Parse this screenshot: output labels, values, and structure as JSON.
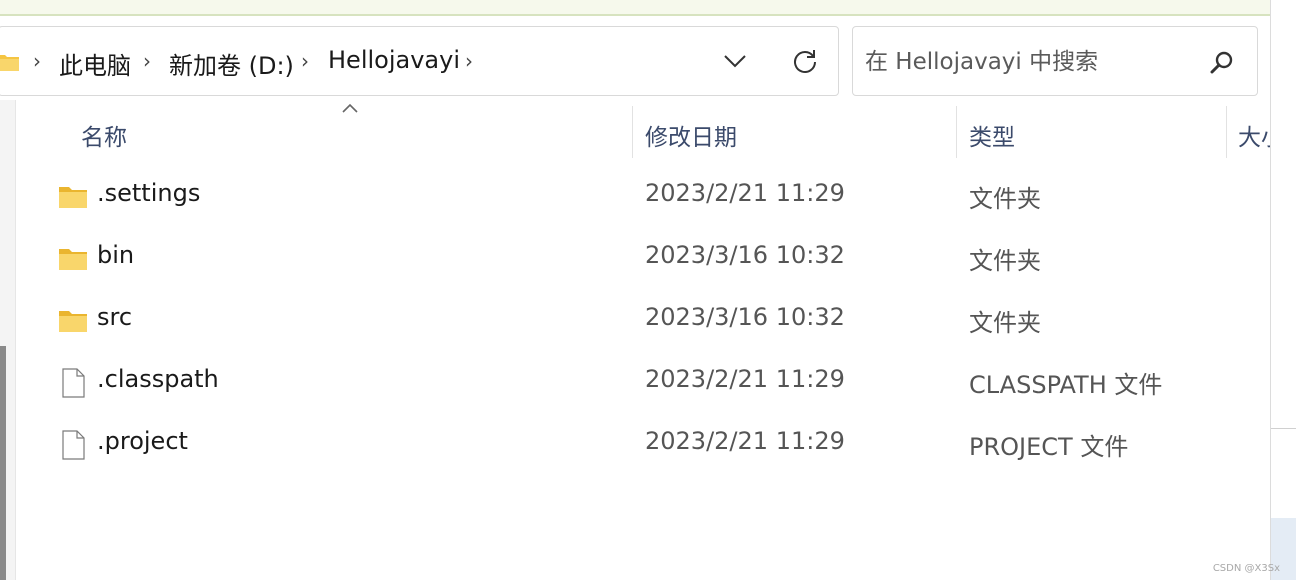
{
  "breadcrumb": {
    "items": [
      {
        "label": "此电脑"
      },
      {
        "label": "新加卷 (D:)"
      },
      {
        "label": "Hellojavayi"
      }
    ],
    "icon": "folder-icon"
  },
  "search": {
    "placeholder": "在 Hellojavayi 中搜索",
    "icon": "search-icon"
  },
  "columns": {
    "name": "名称",
    "date": "修改日期",
    "type": "类型",
    "size": "大小"
  },
  "rows": [
    {
      "name": ".settings",
      "date": "2023/2/21 11:29",
      "type": "文件夹",
      "icon": "folder-icon"
    },
    {
      "name": "bin",
      "date": "2023/3/16 10:32",
      "type": "文件夹",
      "icon": "folder-icon"
    },
    {
      "name": "src",
      "date": "2023/3/16 10:32",
      "type": "文件夹",
      "icon": "folder-icon"
    },
    {
      "name": ".classpath",
      "date": "2023/2/21 11:29",
      "type": "CLASSPATH 文件",
      "icon": "file-icon"
    },
    {
      "name": ".project",
      "date": "2023/2/21 11:29",
      "type": "PROJECT 文件",
      "icon": "file-icon"
    }
  ],
  "watermark": "CSDN @X3Sx",
  "colors": {
    "folder": "#f5c542",
    "header_text": "#3b4a6b",
    "border": "#d9d9d9"
  }
}
